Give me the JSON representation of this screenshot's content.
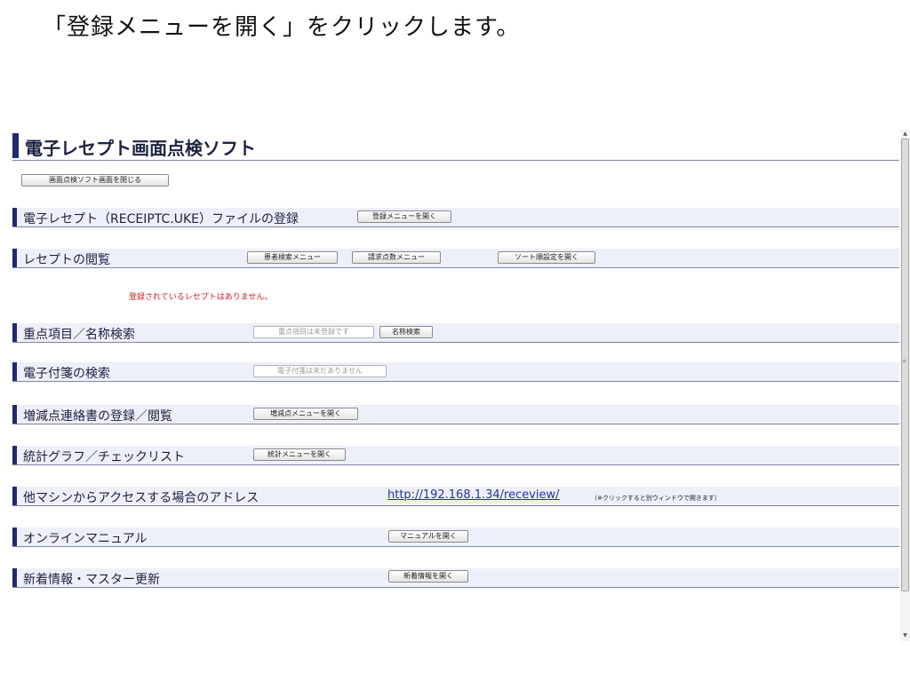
{
  "instruction": "「登録メニューを開く」をクリックします。",
  "app": {
    "title": "電子レセプト画面点検ソフト",
    "close_button": "画面点検ソフト画面を閉じる",
    "sections": {
      "register": {
        "title": "電子レセプト（RECEIPTC.UKE）ファイルの登録",
        "button": "登録メニューを開く"
      },
      "browse": {
        "title": "レセプトの閲覧",
        "patient_button": "患者検索メニュー",
        "billing_button": "請求点数メニュー",
        "sort_button": "ソート順設定を開く",
        "notice": "登録されているレセプトはありません。"
      },
      "priority": {
        "title": "重点項目／名称検索",
        "disabled_button": "重点項目は未登録です",
        "button": "名称検索"
      },
      "sticky": {
        "title": "電子付箋の検索",
        "disabled_button": "電子付箋は未だありません"
      },
      "adjust": {
        "title": "増減点連絡書の登録／閲覧",
        "button": "増減点メニューを開く"
      },
      "stats": {
        "title": "統計グラフ／チェックリスト",
        "button": "統計メニューを開く"
      },
      "access": {
        "title": "他マシンからアクセスする場合のアドレス",
        "url": "http://192.168.1.34/receview/",
        "note": "（※クリックすると別ウィンドウで開きます）"
      },
      "manual": {
        "title": "オンラインマニュアル",
        "button": "マニュアルを開く"
      },
      "news": {
        "title": "新着情報・マスター更新",
        "button": "新着情報を開く"
      }
    }
  },
  "scrollbar": {
    "up_icon": "scroll-up-arrow",
    "down_icon": "scroll-down-arrow",
    "grip_icon": "grip-lines"
  }
}
